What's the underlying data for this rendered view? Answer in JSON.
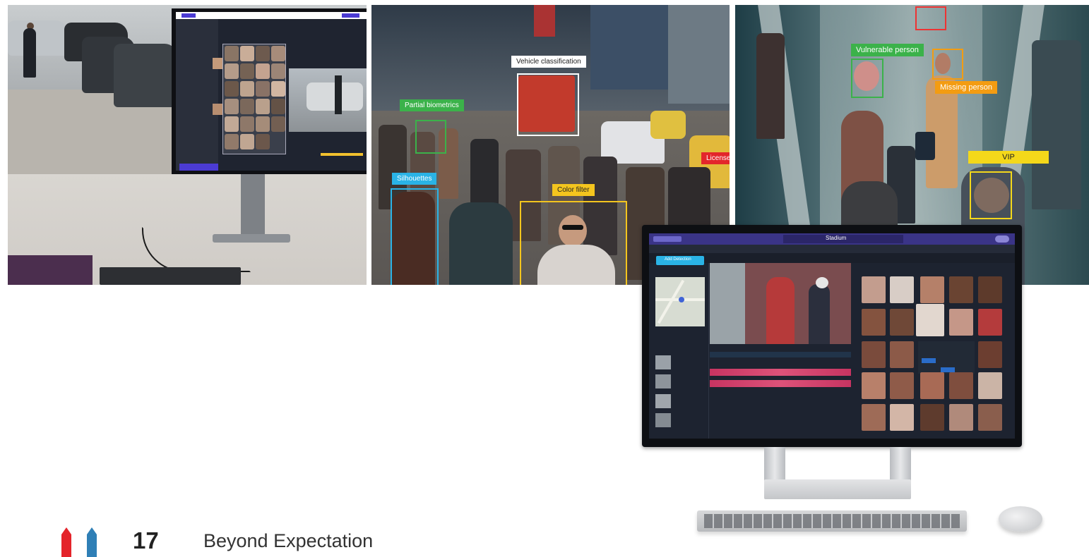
{
  "panels": {
    "crowd": {
      "labels": {
        "vehicle": "Vehicle classification",
        "partial": "Partial biometrics",
        "silhouettes": "Silhouettes",
        "color": "Color filter",
        "license": "License"
      }
    },
    "escalator": {
      "labels": {
        "vulnerable": "Vulnerable person",
        "missing": "Missing person",
        "vip": "VIP"
      }
    }
  },
  "app": {
    "title": "Stadium",
    "button_add": "Add Detection"
  },
  "footer": {
    "page_number": "17",
    "tagline": "Beyond Expectation",
    "logo_colors": [
      "#e4242b",
      "#2f7fb6"
    ]
  }
}
